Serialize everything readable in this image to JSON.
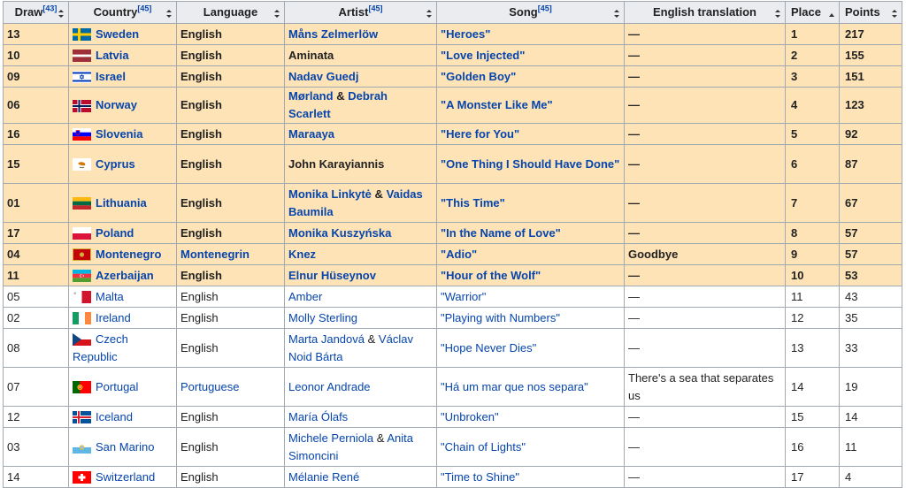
{
  "headers": {
    "draw": "Draw",
    "draw_ref": "[43]",
    "country": "Country",
    "country_ref": "[45]",
    "language": "Language",
    "artist": "Artist",
    "artist_ref": "[45]",
    "song": "Song",
    "song_ref": "[45]",
    "english_translation": "English translation",
    "place": "Place",
    "points": "Points"
  },
  "rows": [
    {
      "draw": "13",
      "country": "Sweden",
      "language": "English",
      "artist": "Måns Zelmerlöw",
      "artist2": "",
      "song": "\"Heroes\"",
      "translation": "—",
      "place": "1",
      "points": "217",
      "qualified": true
    },
    {
      "draw": "10",
      "country": "Latvia",
      "language": "English",
      "artist": "Aminata",
      "artist2": "",
      "song": "\"Love Injected\"",
      "translation": "—",
      "place": "2",
      "points": "155",
      "qualified": true
    },
    {
      "draw": "09",
      "country": "Israel",
      "language": "English",
      "artist": "Nadav Guedj",
      "artist2": "",
      "song": "\"Golden Boy\"",
      "translation": "—",
      "place": "3",
      "points": "151",
      "qualified": true
    },
    {
      "draw": "06",
      "country": "Norway",
      "language": "English",
      "artist": "Mørland",
      "artist2": "Debrah Scarlett",
      "song": "\"A Monster Like Me\"",
      "translation": "—",
      "place": "4",
      "points": "123",
      "qualified": true
    },
    {
      "draw": "16",
      "country": "Slovenia",
      "language": "English",
      "artist": "Maraaya",
      "artist2": "",
      "song": "\"Here for You\"",
      "translation": "—",
      "place": "5",
      "points": "92",
      "qualified": true
    },
    {
      "draw": "15",
      "country": "Cyprus",
      "language": "English",
      "artist": "John Karayiannis",
      "artist2": "",
      "song": "\"One Thing I Should Have Done\"",
      "translation": "—",
      "place": "6",
      "points": "87",
      "qualified": true
    },
    {
      "draw": "01",
      "country": "Lithuania",
      "language": "English",
      "artist": "Monika Linkytė",
      "artist2": "Vaidas Baumila",
      "song": "\"This Time\"",
      "translation": "—",
      "place": "7",
      "points": "67",
      "qualified": true
    },
    {
      "draw": "17",
      "country": "Poland",
      "language": "English",
      "artist": "Monika Kuszyńska",
      "artist2": "",
      "song": "\"In the Name of Love\"",
      "translation": "—",
      "place": "8",
      "points": "57",
      "qualified": true
    },
    {
      "draw": "04",
      "country": "Montenegro",
      "language": "Montenegrin",
      "artist": "Knez",
      "artist2": "",
      "song": "\"Adio\"",
      "translation": "Goodbye",
      "place": "9",
      "points": "57",
      "qualified": true
    },
    {
      "draw": "11",
      "country": "Azerbaijan",
      "language": "English",
      "artist": "Elnur Hüseynov",
      "artist2": "",
      "song": "\"Hour of the Wolf\"",
      "translation": "—",
      "place": "10",
      "points": "53",
      "qualified": true
    },
    {
      "draw": "05",
      "country": "Malta",
      "language": "English",
      "artist": "Amber",
      "artist2": "",
      "song": "\"Warrior\"",
      "translation": "—",
      "place": "11",
      "points": "43",
      "qualified": false
    },
    {
      "draw": "02",
      "country": "Ireland",
      "language": "English",
      "artist": "Molly Sterling",
      "artist2": "",
      "song": "\"Playing with Numbers\"",
      "translation": "—",
      "place": "12",
      "points": "35",
      "qualified": false
    },
    {
      "draw": "08",
      "country": "Czech Republic",
      "language": "English",
      "artist": "Marta Jandová",
      "artist2": "Václav Noid Bárta",
      "song": "\"Hope Never Dies\"",
      "translation": "—",
      "place": "13",
      "points": "33",
      "qualified": false
    },
    {
      "draw": "07",
      "country": "Portugal",
      "language": "Portuguese",
      "artist": "Leonor Andrade",
      "artist2": "",
      "song": "\"Há um mar que nos separa\"",
      "translation": "There's a sea that separates us",
      "place": "14",
      "points": "19",
      "qualified": false
    },
    {
      "draw": "12",
      "country": "Iceland",
      "language": "English",
      "artist": "María Ólafs",
      "artist2": "",
      "song": "\"Unbroken\"",
      "translation": "—",
      "place": "15",
      "points": "14",
      "qualified": false
    },
    {
      "draw": "03",
      "country": "San Marino",
      "language": "English",
      "artist": "Michele Perniola",
      "artist2": "Anita Simoncini",
      "song": "\"Chain of Lights\"",
      "translation": "—",
      "place": "16",
      "points": "11",
      "qualified": false
    },
    {
      "draw": "14",
      "country": "Switzerland",
      "language": "English",
      "artist": "Mélanie René",
      "artist2": "",
      "song": "\"Time to Shine\"",
      "translation": "—",
      "place": "17",
      "points": "4",
      "qualified": false
    }
  ],
  "artist_joiner": "&",
  "flag_icons": [
    "sweden-flag-icon",
    "latvia-flag-icon",
    "israel-flag-icon",
    "norway-flag-icon",
    "slovenia-flag-icon",
    "cyprus-flag-icon",
    "lithuania-flag-icon",
    "poland-flag-icon",
    "montenegro-flag-icon",
    "azerbaijan-flag-icon",
    "malta-flag-icon",
    "ireland-flag-icon",
    "czech-republic-flag-icon",
    "portugal-flag-icon",
    "iceland-flag-icon",
    "san-marino-flag-icon",
    "switzerland-flag-icon"
  ],
  "colors": {
    "qualified_row": "#fde3b6",
    "header": "#eaecf0",
    "link": "#0645ad",
    "border": "#a2a9b1"
  }
}
